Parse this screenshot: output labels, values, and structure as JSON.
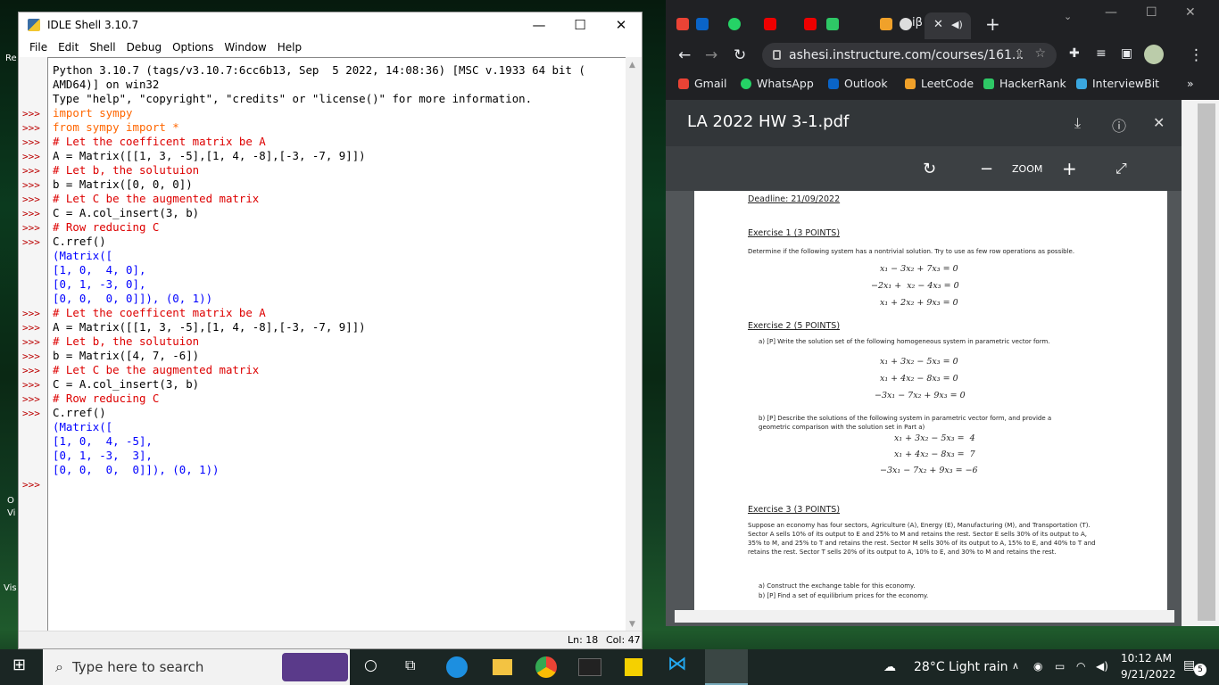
{
  "desktop": {
    "fragments": [
      "Re",
      "O",
      "Vi",
      "Vis"
    ]
  },
  "idle": {
    "title": "IDLE Shell 3.10.7",
    "menu": [
      "File",
      "Edit",
      "Shell",
      "Debug",
      "Options",
      "Window",
      "Help"
    ],
    "prompt": ">>>",
    "banner": [
      "Python 3.10.7 (tags/v3.10.7:6cc6b13, Sep  5 2022, 14:08:36) [MSC v.1933 64 bit (",
      "AMD64)] on win32",
      "Type \"help\", \"copyright\", \"credits\" or \"license()\" for more information."
    ],
    "lines": [
      {
        "t": "import sympy",
        "c": "kw"
      },
      {
        "t": "from sympy import *",
        "c": "kw"
      },
      {
        "t": "# Let the coefficent matrix be A",
        "c": "cm"
      },
      {
        "t": "A = Matrix([[1, 3, -5],[1, 4, -8],[-3, -7, 9]])",
        "c": "tx"
      },
      {
        "t": "# Let b, the solutuion",
        "c": "cm"
      },
      {
        "t": "b = Matrix([0, 0, 0])",
        "c": "tx"
      },
      {
        "t": "# Let C be the augmented matrix",
        "c": "cm"
      },
      {
        "t": "C = A.col_insert(3, b)",
        "c": "tx"
      },
      {
        "t": "# Row reducing C",
        "c": "cm"
      },
      {
        "t": "C.rref()",
        "c": "tx"
      },
      {
        "t": "(Matrix([",
        "c": "out"
      },
      {
        "t": "[1, 0,  4, 0],",
        "c": "out"
      },
      {
        "t": "[0, 1, -3, 0],",
        "c": "out"
      },
      {
        "t": "[0, 0,  0, 0]]), (0, 1))",
        "c": "out"
      },
      {
        "t": "# Let the coefficent matrix be A",
        "c": "cm"
      },
      {
        "t": "A = Matrix([[1, 3, -5],[1, 4, -8],[-3, -7, 9]])",
        "c": "tx"
      },
      {
        "t": "# Let b, the solutuion",
        "c": "cm"
      },
      {
        "t": "b = Matrix([4, 7, -6])",
        "c": "tx"
      },
      {
        "t": "# Let C be the augmented matrix",
        "c": "cm"
      },
      {
        "t": "C = A.col_insert(3, b)",
        "c": "tx"
      },
      {
        "t": "# Row reducing C",
        "c": "cm"
      },
      {
        "t": "C.rref()",
        "c": "tx"
      },
      {
        "t": "(Matrix([",
        "c": "out"
      },
      {
        "t": "[1, 0,  4, -5],",
        "c": "out"
      },
      {
        "t": "[0, 1, -3,  3],",
        "c": "out"
      },
      {
        "t": "[0, 0,  0,  0]]), (0, 1))",
        "c": "out"
      }
    ],
    "status": {
      "line": "Ln: 18",
      "col": "Col: 47"
    }
  },
  "chrome": {
    "url": "ashesi.instructure.com/courses/161...",
    "bookmarks": [
      {
        "label": "Gmail",
        "color": "#ea4335"
      },
      {
        "label": "WhatsApp",
        "color": "#25d366"
      },
      {
        "label": "Outlook",
        "color": "#0a64c8"
      },
      {
        "label": "LeetCode",
        "color": "#f0a12a"
      },
      {
        "label": "HackerRank",
        "color": "#2ec866"
      },
      {
        "label": "InterviewBit",
        "color": "#3aa7e0"
      }
    ],
    "tab_labels": [
      "M",
      "o",
      "10",
      "iβ"
    ],
    "pdf": {
      "title": "LA 2022 HW 3-1.pdf",
      "zoom_label": "ZOOM",
      "deadline": "Deadline: 21/09/2022",
      "ex1": {
        "h": "Exercise 1 (3 POINTS)",
        "p": "Determine if the following system has a nontrivial solution. Try to use as few row operations as possible.",
        "eq": [
          "x₁ − 3x₂ + 7x₃ = 0",
          "−2x₁ +  x₂ − 4x₃ = 0",
          "x₁ + 2x₂ + 9x₃ = 0"
        ]
      },
      "ex2": {
        "h": "Exercise 2 (5 POINTS)",
        "a": "a)   [P] Write the solution set of the following homogeneous system in parametric vector form.",
        "eqa": [
          "x₁ + 3x₂ − 5x₃ = 0",
          "x₁ + 4x₂ − 8x₃ = 0",
          "−3x₁ − 7x₂ + 9x₃ = 0"
        ],
        "b": "b)   [P] Describe the solutions of the following system in parametric vector form, and provide a geometric comparison with the solution set in Part a)",
        "eqb": [
          "x₁ + 3x₂ − 5x₃ =  4",
          "x₁ + 4x₂ − 8x₃ =  7",
          "−3x₁ − 7x₂ + 9x₃ = −6"
        ]
      },
      "ex3": {
        "h": "Exercise 3 (3 POINTS)",
        "p": "Suppose an economy has four sectors, Agriculture (A), Energy (E), Manufacturing (M), and Transportation (T). Sector A sells 10% of its output to E and 25% to M and retains the rest. Sector E sells 30% of its output to A, 35% to M, and 25% to T and retains the rest. Sector M sells 30% of its output to A, 15% to E, and 40% to T and retains the rest. Sector T sells 20% of its output to A, 10% to E, and 30% to M and retains the rest.",
        "a": "a)   Construct the exchange table for this economy.",
        "b": "b)   [P] Find a set of equilibrium prices for the economy."
      }
    }
  },
  "taskbar": {
    "search_placeholder": "Type here to search",
    "weather": "28°C  Light rain",
    "time": "10:12 AM",
    "date": "9/21/2022",
    "notif_count": "5"
  }
}
